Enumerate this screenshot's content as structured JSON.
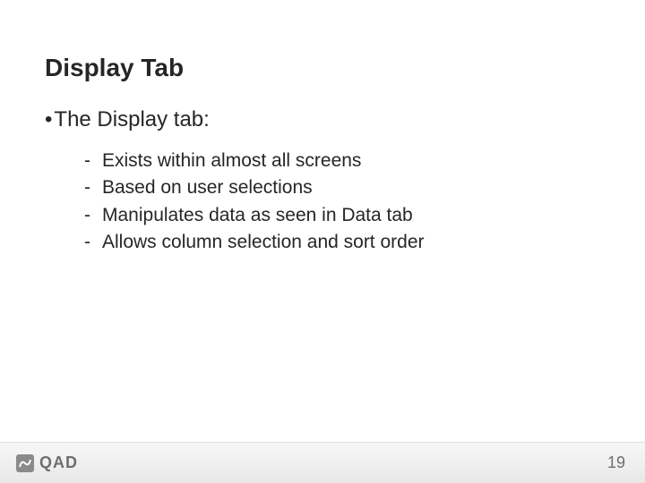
{
  "title": "Display Tab",
  "level1_bullet": "•",
  "level1_text": "The Display tab:",
  "dash": "-",
  "sub_items": [
    "Exists within almost all screens",
    "Based on user selections",
    "Manipulates data as seen in Data tab",
    "Allows column selection and sort order"
  ],
  "logo_text": "QAD",
  "page_number": "19"
}
